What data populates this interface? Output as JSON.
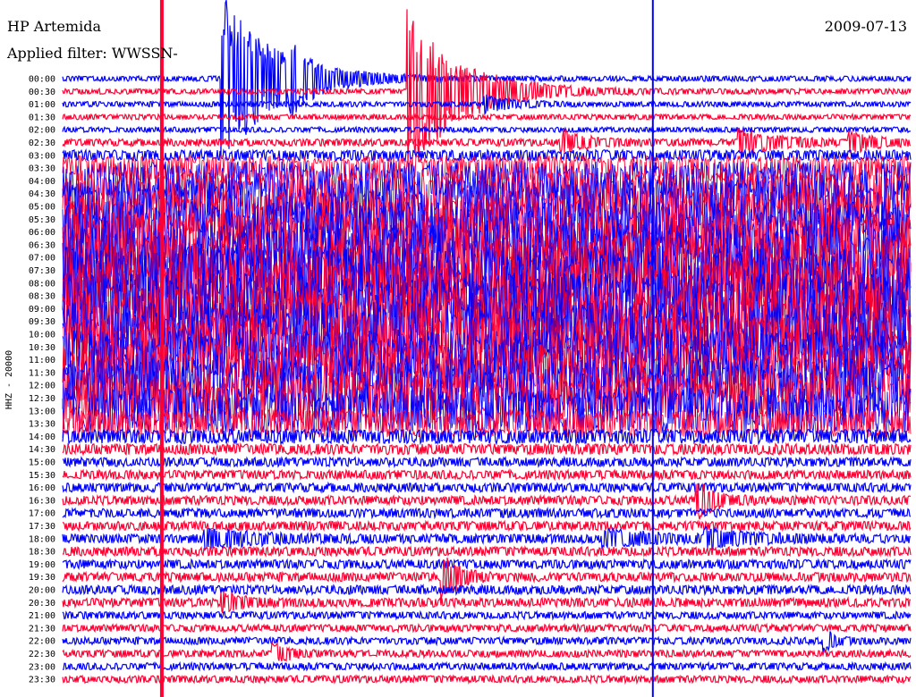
{
  "header": {
    "station": "HP Artemida",
    "date": "2009-07-13",
    "filter_text": "Applied filter: WWSSN-"
  },
  "chart_data": {
    "type": "line",
    "title": "HP Artemida",
    "subtitle": "2009-07-13",
    "ylabel": "HHZ - 20000",
    "grid": false,
    "colors": {
      "even_rows": "#0000ff",
      "odd_rows": "#ff0033"
    },
    "rows": [
      "00:00",
      "00:30",
      "01:00",
      "01:30",
      "02:00",
      "02:30",
      "03:00",
      "03:30",
      "04:00",
      "04:30",
      "05:00",
      "05:30",
      "06:00",
      "06:30",
      "07:00",
      "07:30",
      "08:00",
      "08:30",
      "09:00",
      "09:30",
      "10:00",
      "10:30",
      "11:00",
      "11:30",
      "12:00",
      "12:30",
      "13:00",
      "13:30",
      "14:00",
      "14:30",
      "15:00",
      "15:30",
      "16:00",
      "16:30",
      "17:00",
      "17:30",
      "18:00",
      "18:30",
      "19:00",
      "19:30",
      "20:00",
      "20:30",
      "21:00",
      "21:30",
      "22:00",
      "22:30",
      "23:00",
      "23:30"
    ],
    "noise_amplitude": [
      3,
      3,
      3,
      3,
      3,
      4,
      6,
      14,
      22,
      26,
      30,
      32,
      34,
      36,
      38,
      40,
      42,
      40,
      40,
      38,
      36,
      34,
      34,
      32,
      30,
      28,
      26,
      16,
      8,
      6,
      5,
      5,
      5,
      5,
      5,
      5,
      5,
      5,
      5,
      5,
      5,
      5,
      4,
      4,
      4,
      4,
      4,
      4
    ],
    "events": [
      {
        "row": 0,
        "x": 0.19,
        "amp": 95,
        "width": 0.06
      },
      {
        "row": 1,
        "x": 0.41,
        "amp": 90,
        "width": 0.06
      },
      {
        "row": 0,
        "x": 0.27,
        "amp": 20,
        "width": 0.02
      },
      {
        "row": 2,
        "x": 0.5,
        "amp": 10,
        "width": 0.03
      },
      {
        "row": 5,
        "x": 0.59,
        "amp": 12,
        "width": 0.03
      },
      {
        "row": 5,
        "x": 0.8,
        "amp": 14,
        "width": 0.04
      },
      {
        "row": 5,
        "x": 0.93,
        "amp": 10,
        "width": 0.03
      },
      {
        "row": 33,
        "x": 0.75,
        "amp": 20,
        "width": 0.02
      },
      {
        "row": 36,
        "x": 0.17,
        "amp": 10,
        "width": 0.06
      },
      {
        "row": 36,
        "x": 0.64,
        "amp": 10,
        "width": 0.05
      },
      {
        "row": 36,
        "x": 0.76,
        "amp": 10,
        "width": 0.05
      },
      {
        "row": 39,
        "x": 0.45,
        "amp": 22,
        "width": 0.02
      },
      {
        "row": 41,
        "x": 0.19,
        "amp": 10,
        "width": 0.02
      },
      {
        "row": 44,
        "x": 0.9,
        "amp": 12,
        "width": 0.01
      },
      {
        "row": 45,
        "x": 0.25,
        "amp": 10,
        "width": 0.02
      }
    ],
    "vertical_lines": [
      {
        "x": 0.117,
        "color": "#ff0033"
      },
      {
        "x": 0.696,
        "color": "#0000ff"
      }
    ]
  }
}
